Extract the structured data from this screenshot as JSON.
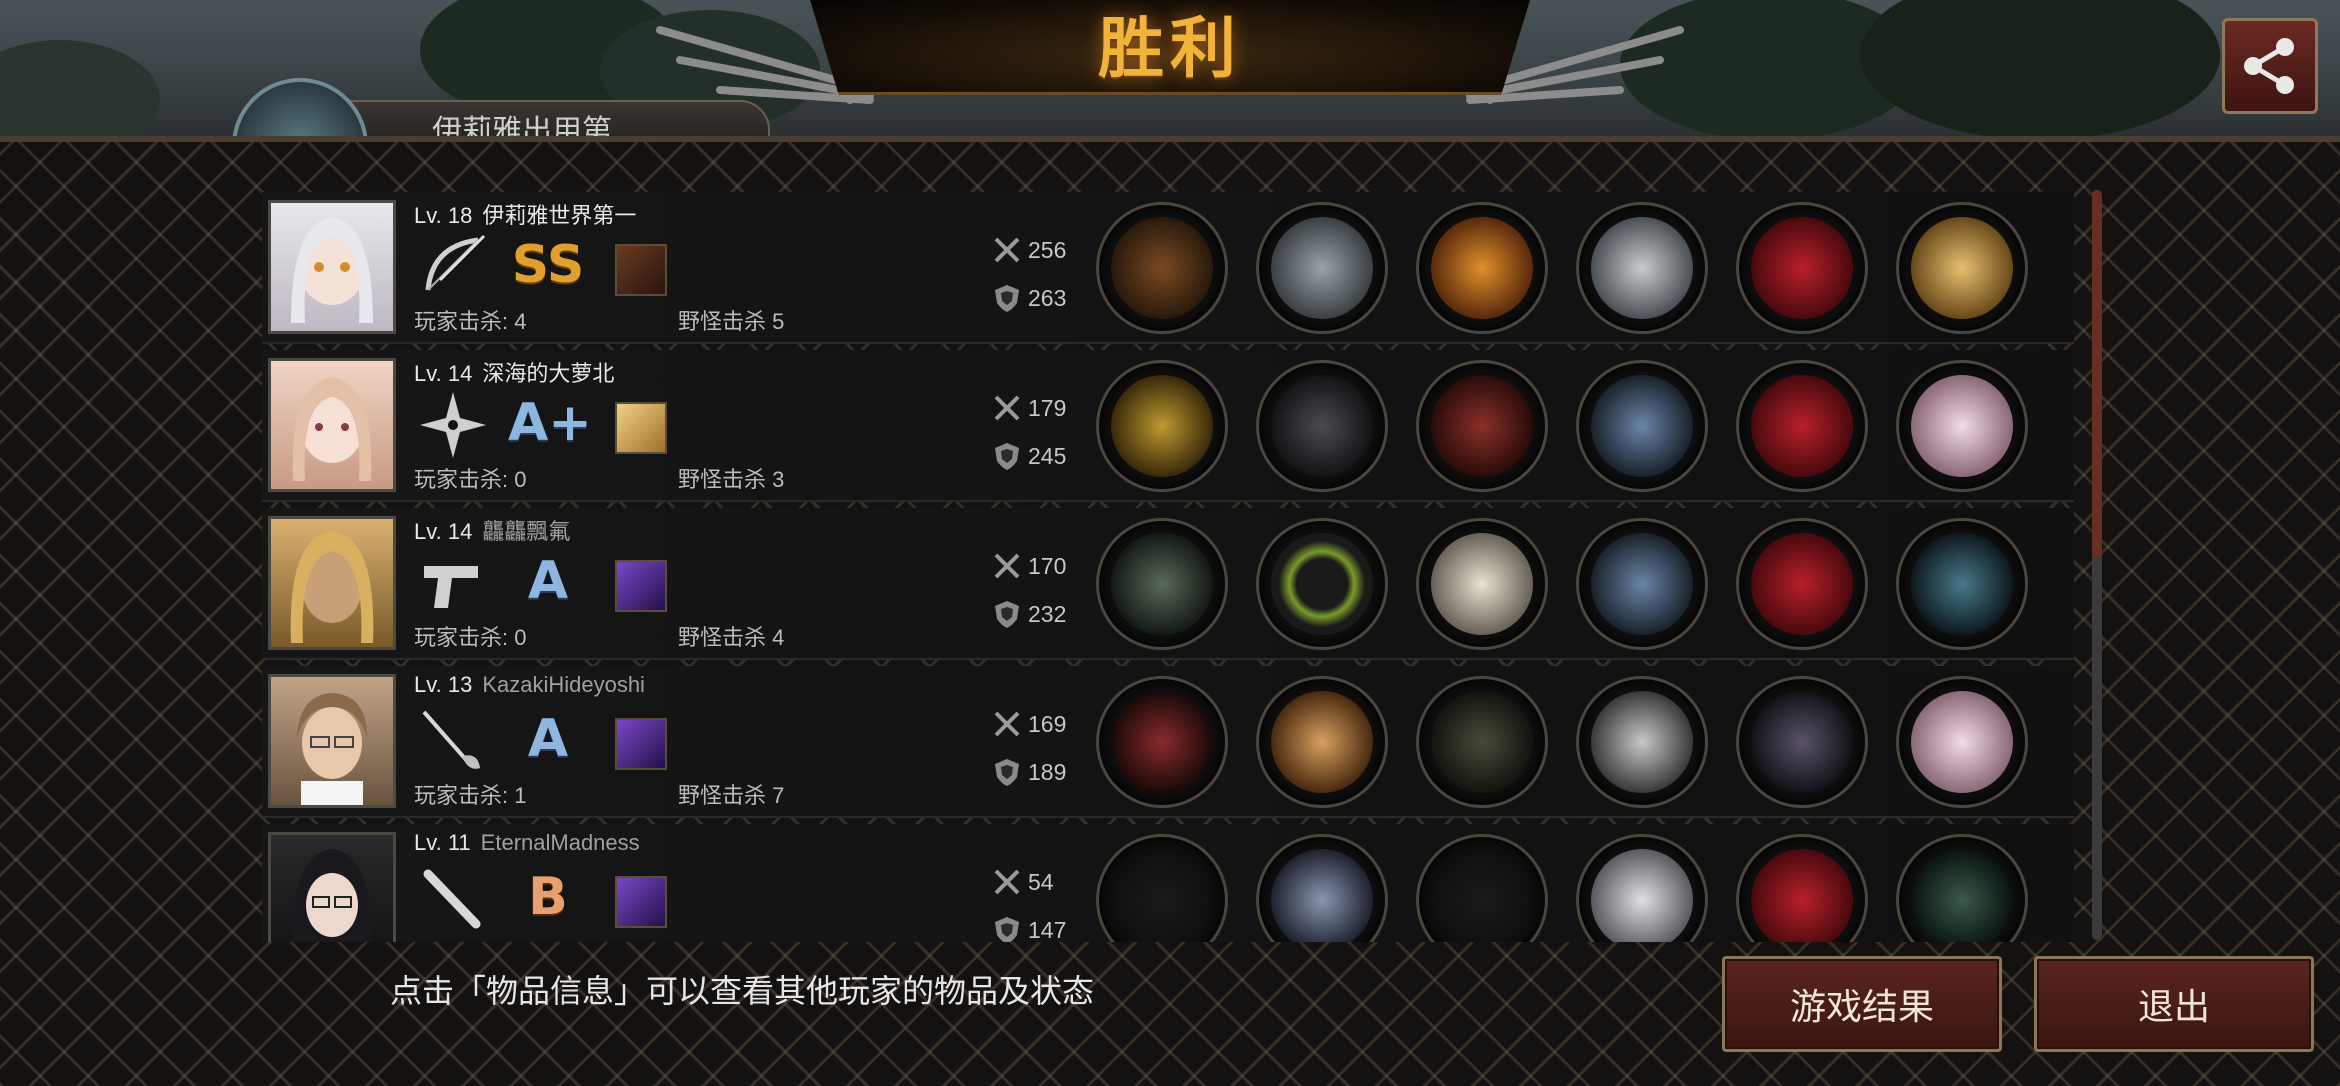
{
  "header": {
    "title": "胜利",
    "team_tab_label": "伊莉雅出用第"
  },
  "players": [
    {
      "level": "Lv. 18",
      "name": "伊莉雅世界第一",
      "grade": "SS",
      "grade_color": "#e0a030",
      "weapon_icon": "bow-icon",
      "player_kills": "玩家击杀: 4",
      "monster_kills": "野怪击杀 5",
      "attack": "256",
      "defense": "263",
      "portrait_color": "#d9d6dc"
    },
    {
      "level": "Lv. 14",
      "name": "深海的大萝北",
      "grade": "A+",
      "grade_color": "#8fb6e0",
      "weapon_icon": "shuriken-icon",
      "player_kills": "玩家击杀: 0",
      "monster_kills": "野怪击杀 3",
      "attack": "179",
      "defense": "245",
      "portrait_color": "#e8cbb8"
    },
    {
      "level": "Lv. 14",
      "name": "龘龘飄氟",
      "grade": "A",
      "grade_color": "#8fb6e0",
      "weapon_icon": "pistol-icon",
      "player_kills": "玩家击杀: 0",
      "monster_kills": "野怪击杀 4",
      "attack": "170",
      "defense": "232",
      "portrait_color": "#c8a060"
    },
    {
      "level": "Lv. 13",
      "name": "KazakiHideyoshi",
      "grade": "A",
      "grade_color": "#8fb6e0",
      "weapon_icon": "rapier-icon",
      "player_kills": "玩家击杀: 1",
      "monster_kills": "野怪击杀 7",
      "attack": "169",
      "defense": "189",
      "portrait_color": "#b89a78"
    },
    {
      "level": "Lv. 11",
      "name": "EternalMadness",
      "grade": "B",
      "grade_color": "#e8a070",
      "weapon_icon": "bat-icon",
      "player_kills": "",
      "monster_kills": "",
      "attack": "54",
      "defense": "147",
      "portrait_color": "#3a3a3a"
    }
  ],
  "footer": {
    "hint": "点击「物品信息」可以查看其他玩家的物品及状态",
    "result_button": "游戏结果",
    "exit_button": "退出"
  },
  "colors": {
    "accent_gold": "#f2b33a",
    "button_red": "#5a261e"
  }
}
